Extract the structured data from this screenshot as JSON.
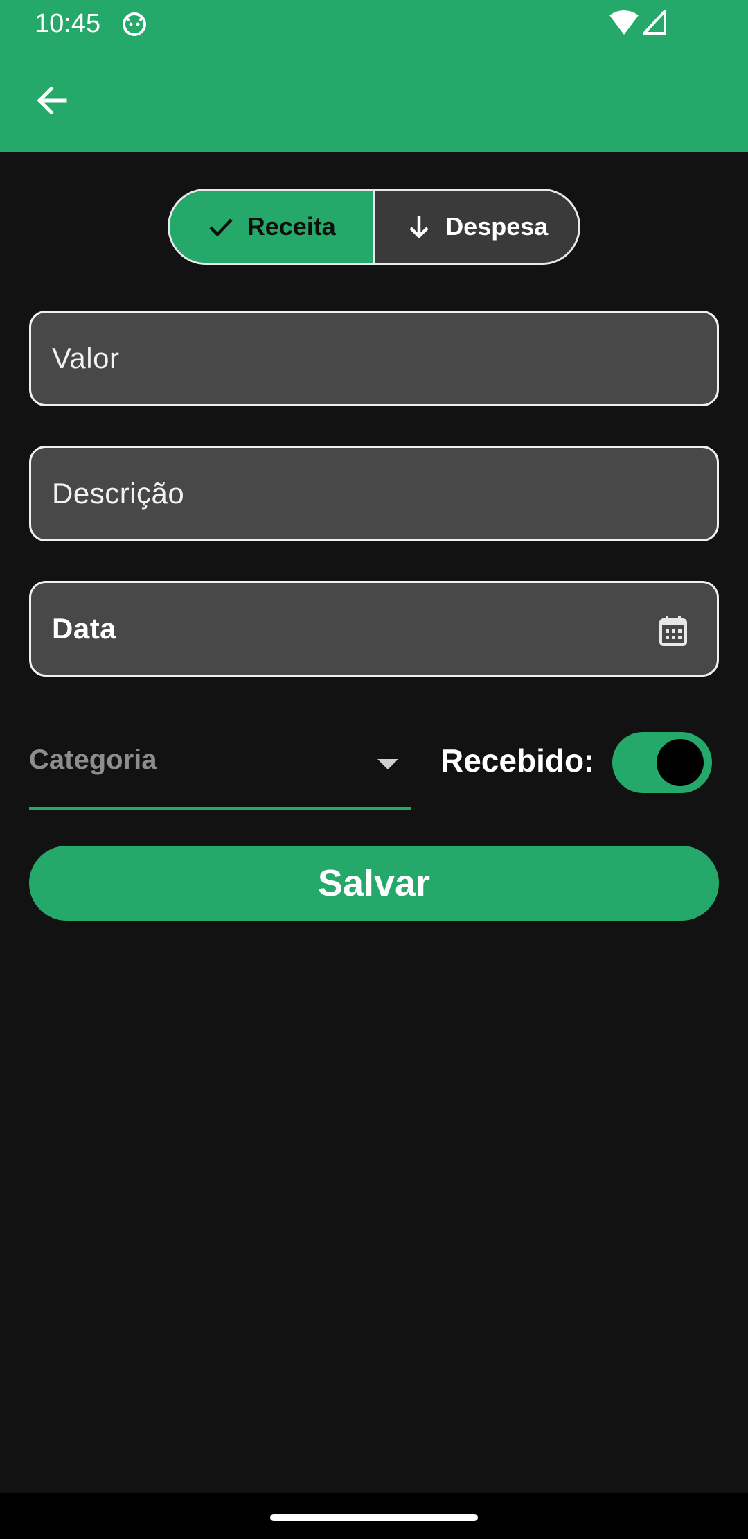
{
  "status_bar": {
    "time": "10:45",
    "icons": [
      "cat-notification-icon",
      "wifi-icon",
      "signal-icon"
    ]
  },
  "app_bar": {
    "back_icon": "arrow-left-icon"
  },
  "type_selector": {
    "options": [
      {
        "label": "Receita",
        "icon": "check-icon",
        "selected": true
      },
      {
        "label": "Despesa",
        "icon": "arrow-down-icon",
        "selected": false
      }
    ]
  },
  "form": {
    "valor_label": "Valor",
    "descricao_label": "Descrição",
    "data_label": "Data",
    "categoria_placeholder": "Categoria",
    "recebido_label": "Recebido:",
    "recebido_on": true,
    "save_label": "Salvar"
  },
  "colors": {
    "accent": "#24a96a",
    "background": "#121212",
    "field_bg": "#484848"
  }
}
